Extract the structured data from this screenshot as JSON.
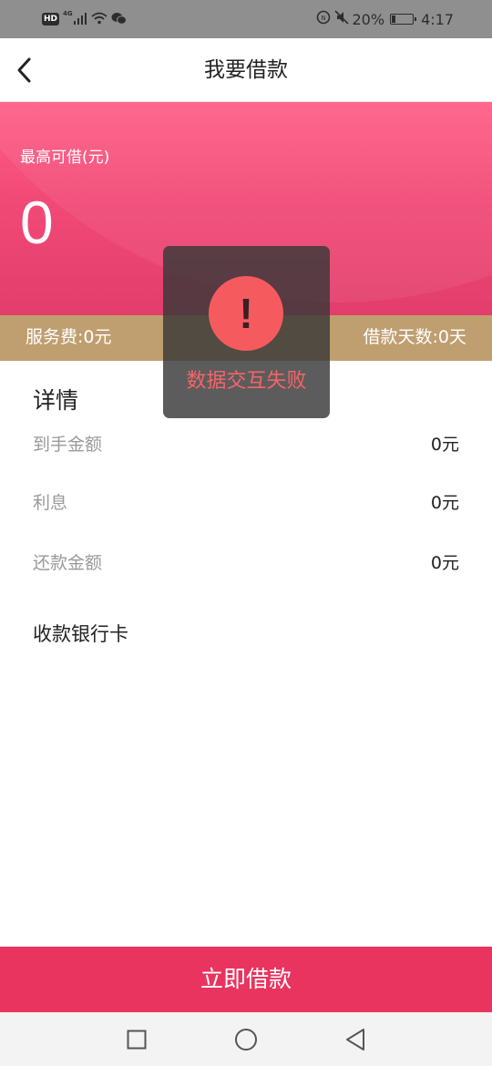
{
  "status_bar": {
    "hd_badge": "HD",
    "network_label": "4G",
    "battery_percent": "20%",
    "battery_level": 0.2,
    "time": "4:17",
    "icons": [
      "hd-badge",
      "cell-signal-icon",
      "wifi-icon",
      "wechat-icon",
      "nfc-icon",
      "mute-icon",
      "battery-icon"
    ]
  },
  "header": {
    "title": "我要借款",
    "back_icon": "chevron-left-icon"
  },
  "hero": {
    "label": "最高可借(元)",
    "amount": "0"
  },
  "fee_strip": {
    "service_fee": "服务费:0元",
    "loan_days": "借款天数:0天"
  },
  "details": {
    "title": "详情",
    "rows": [
      {
        "label": "到手金额",
        "value": "0元"
      },
      {
        "label": "利息",
        "value": "0元"
      },
      {
        "label": "还款金额",
        "value": "0元"
      }
    ],
    "bank_card_label": "收款银行卡"
  },
  "toast": {
    "icon": "exclamation-icon",
    "icon_glyph": "!",
    "message": "数据交互失败"
  },
  "primary_button": {
    "label": "立即借款"
  },
  "nav_bar": {
    "icons": [
      "recents-square-icon",
      "home-circle-icon",
      "back-triangle-icon"
    ]
  },
  "colors": {
    "hero_pink": "#f24a77",
    "fee_gold": "#bf9e70",
    "button_red": "#e8345e",
    "toast_circle": "#f55b5e",
    "toast_text": "#f56468"
  }
}
